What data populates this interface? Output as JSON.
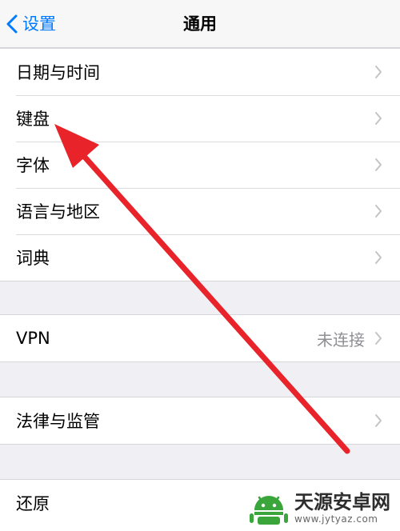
{
  "nav": {
    "back_label": "设置",
    "title": "通用"
  },
  "groups": {
    "g1": [
      {
        "label": "日期与时间"
      },
      {
        "label": "键盘"
      },
      {
        "label": "字体"
      },
      {
        "label": "语言与地区"
      },
      {
        "label": "词典"
      }
    ],
    "vpn": {
      "label": "VPN",
      "value": "未连接"
    },
    "legal": {
      "label": "法律与监管"
    },
    "reset": {
      "label": "还原"
    }
  },
  "watermark": {
    "site": "天源安卓网",
    "url": "www.jytyaz.com"
  },
  "colors": {
    "accent": "#007aff",
    "annotation_arrow": "#e8232a",
    "background": "#efeff4",
    "watermark_green": "#3aa53a"
  }
}
